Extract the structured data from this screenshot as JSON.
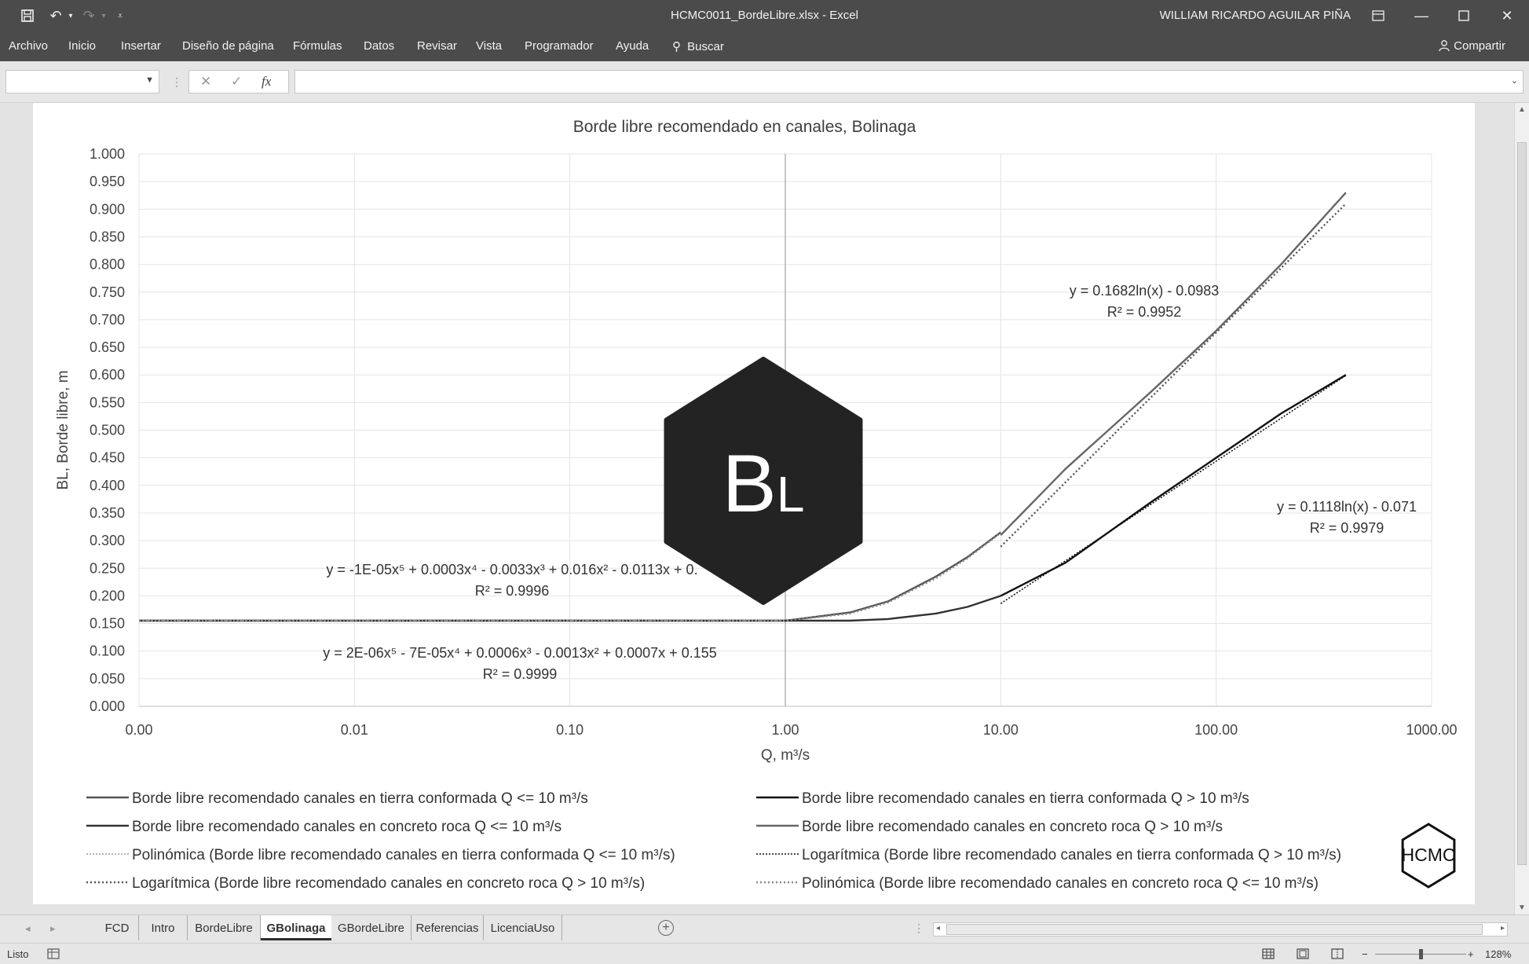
{
  "window": {
    "title": "HCMC0011_BordeLibre.xlsx  -  Excel",
    "user": "WILLIAM RICARDO AGUILAR PIÑA"
  },
  "ribbon": {
    "tabs": [
      "Archivo",
      "Inicio",
      "Insertar",
      "Diseño de página",
      "Fórmulas",
      "Datos",
      "Revisar",
      "Vista",
      "Programador",
      "Ayuda"
    ],
    "search_label": "Buscar",
    "share_label": "Compartir"
  },
  "formula_bar": {
    "name_box": "",
    "formula": "",
    "fx_label": "fx"
  },
  "logo": {
    "big": "BL",
    "small": "HCMC"
  },
  "chart_data": {
    "type": "scatter",
    "title": "Borde libre recomendado en canales, Bolinaga",
    "xlabel": "Q, m³/s",
    "ylabel": "BL, Borde libre, m",
    "x_scale": "log",
    "xlim": [
      0.001,
      1000
    ],
    "ylim": [
      0,
      1
    ],
    "x_tick_labels": [
      "0.00",
      "0.01",
      "0.10",
      "1.00",
      "10.00",
      "100.00",
      "1000.00"
    ],
    "y_tick_labels": [
      "0.000",
      "0.050",
      "0.100",
      "0.150",
      "0.200",
      "0.250",
      "0.300",
      "0.350",
      "0.400",
      "0.450",
      "0.500",
      "0.550",
      "0.600",
      "0.650",
      "0.700",
      "0.750",
      "0.800",
      "0.850",
      "0.900",
      "0.950",
      "1.000"
    ],
    "grid": true,
    "legend_position": "bottom",
    "series": [
      {
        "name": "Borde libre recomendado canales en tierra conformada Q <= 10 m³/s",
        "color": "#555555",
        "style": "solid",
        "x": [
          0.001,
          0.01,
          0.1,
          1,
          2,
          3,
          5,
          7,
          10
        ],
        "y": [
          0.155,
          0.155,
          0.155,
          0.155,
          0.17,
          0.19,
          0.235,
          0.27,
          0.315
        ]
      },
      {
        "name": "Borde libre recomendado canales en tierra conformada Q > 10 m³/s",
        "color": "#111111",
        "style": "solid",
        "x": [
          10,
          20,
          50,
          100,
          200,
          400
        ],
        "y": [
          0.2,
          0.26,
          0.37,
          0.45,
          0.53,
          0.6
        ]
      },
      {
        "name": "Borde libre recomendado canales en concreto roca Q <= 10 m³/s",
        "color": "#333333",
        "style": "solid",
        "x": [
          0.001,
          0.01,
          0.1,
          1,
          2,
          3,
          5,
          7,
          10
        ],
        "y": [
          0.155,
          0.155,
          0.155,
          0.155,
          0.155,
          0.158,
          0.168,
          0.18,
          0.2
        ]
      },
      {
        "name": "Borde libre recomendado canales en concreto roca Q > 10 m³/s",
        "color": "#666666",
        "style": "solid",
        "x": [
          10,
          20,
          50,
          100,
          200,
          400
        ],
        "y": [
          0.31,
          0.43,
          0.57,
          0.68,
          0.8,
          0.93
        ]
      },
      {
        "name": "Polinómica (Borde libre recomendado canales en tierra conformada Q <= 10 m³/s)",
        "color": "#9a9a9a",
        "style": "dotted-fine",
        "x": [
          0.001,
          0.01,
          0.1,
          1
        ],
        "y": [
          0.155,
          0.155,
          0.155,
          0.155
        ]
      },
      {
        "name": "Logarítmica (Borde libre recomendado canales en tierra conformada Q > 10 m³/s)",
        "color": "#111111",
        "style": "dotted-fine",
        "x": [
          10,
          400
        ],
        "y": [
          0.186,
          0.599
        ]
      },
      {
        "name": "Logarítmica (Borde libre recomendado canales en concreto roca Q > 10 m³/s)",
        "color": "#555555",
        "style": "dotted",
        "x": [
          10,
          400
        ],
        "y": [
          0.289,
          0.91
        ]
      },
      {
        "name": "Polinómica (Borde libre recomendado canales en concreto roca Q <= 10 m³/s)",
        "color": "#888888",
        "style": "dotted",
        "x": [
          0.001,
          0.01,
          0.1,
          1,
          2,
          3,
          5,
          7,
          10
        ],
        "y": [
          0.155,
          0.155,
          0.155,
          0.155,
          0.168,
          0.188,
          0.232,
          0.268,
          0.314
        ]
      }
    ],
    "annotations": [
      {
        "line1": "y = 0.1682ln(x) - 0.0983",
        "line2": "R² = 0.9952"
      },
      {
        "line1": "y = 0.1118ln(x) - 0.071",
        "line2": "R² = 0.9979"
      },
      {
        "line1": "y = -1E-05x⁵ + 0.0003x⁴ - 0.0033x³ + 0.016x² - 0.0113x + 0.",
        "line2": "R² = 0.9996"
      },
      {
        "line1": "y = 2E-06x⁵ - 7E-05x⁴ + 0.0006x³ - 0.0013x² + 0.0007x + 0.155",
        "line2": "R² = 0.9999"
      }
    ]
  },
  "sheet_tabs": [
    "FCD",
    "Intro",
    "BordeLibre",
    "GBolinaga",
    "GBordeLibre",
    "Referencias",
    "LicenciaUso"
  ],
  "active_sheet": "GBolinaga",
  "status": {
    "ready": "Listo",
    "zoom": "128%"
  }
}
